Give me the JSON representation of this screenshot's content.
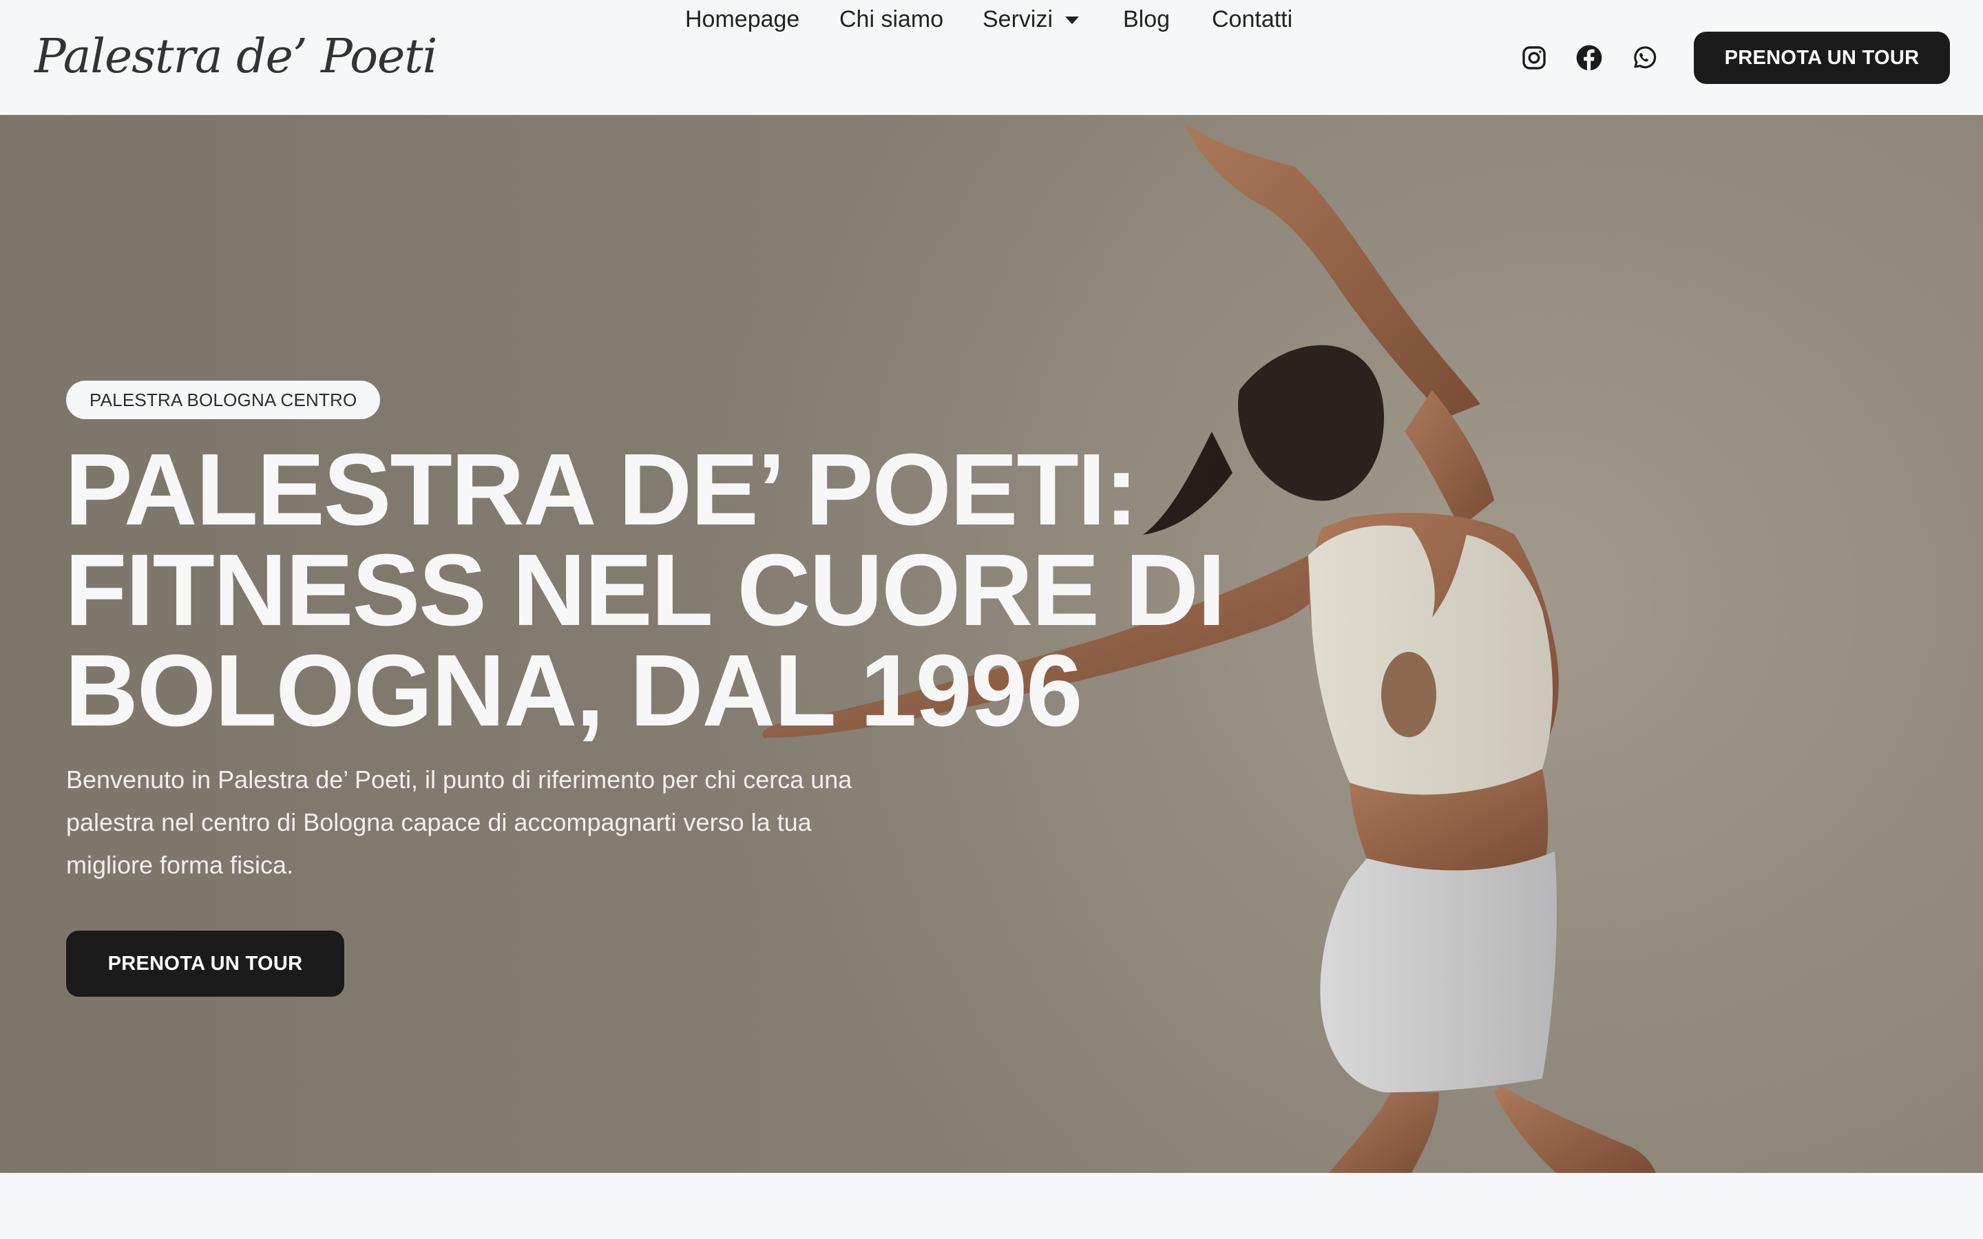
{
  "header": {
    "logo": "Palestra de’ Poeti",
    "nav": [
      {
        "label": "Homepage"
      },
      {
        "label": "Chi siamo"
      },
      {
        "label": "Servizi",
        "has_dropdown": true
      },
      {
        "label": "Blog"
      },
      {
        "label": "Contatti"
      }
    ],
    "social_icons": [
      "instagram-icon",
      "facebook-icon",
      "whatsapp-icon"
    ],
    "cta_label": "PRENOTA UN TOUR"
  },
  "hero": {
    "badge": "PALESTRA BOLOGNA CENTRO",
    "title_lines": [
      "PALESTRA DE’ POETI:",
      "FITNESS NEL CUORE DI",
      "BOLOGNA, DAL 1996"
    ],
    "text_lines": [
      "Benvenuto in Palestra de’ Poeti, il punto di riferimento per chi cerca una",
      "palestra nel centro di Bologna capace di accompagnarti verso la tua",
      "migliore forma fisica."
    ],
    "cta_label": "PRENOTA UN TOUR"
  },
  "colors": {
    "page_background": "#f6f7f9",
    "button_background": "#1b1b1b",
    "hero_background": "#968f82",
    "hero_text": "#f7f7f7"
  }
}
